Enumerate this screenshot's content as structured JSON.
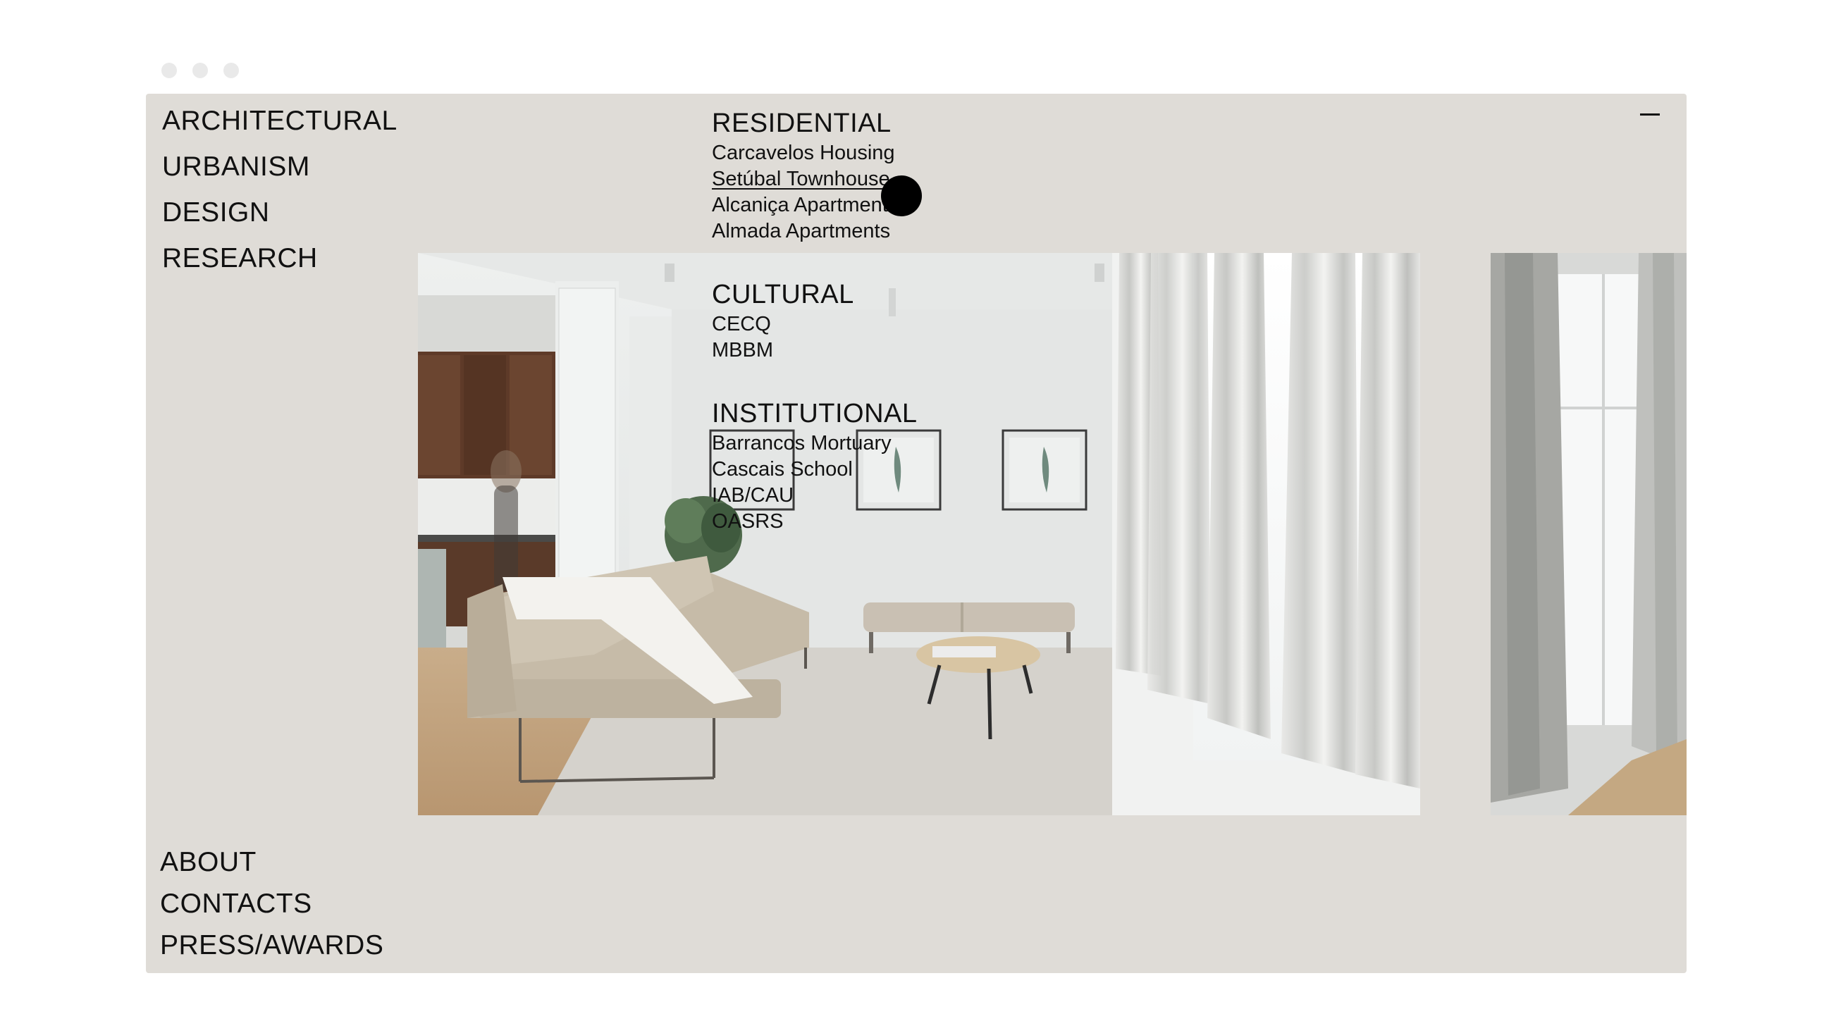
{
  "nav": {
    "main": [
      "ARCHITECTURAL",
      "URBANISM",
      "DESIGN",
      "RESEARCH"
    ],
    "footer": [
      "ABOUT",
      "CONTACTS",
      "PRESS/AWARDS"
    ]
  },
  "menu": {
    "categories": [
      {
        "title": "RESIDENTIAL",
        "items": [
          "Carcavelos Housing",
          "Setúbal Townhouse",
          "Alcaniça Apartments",
          "Almada Apartments"
        ]
      },
      {
        "title": "CULTURAL",
        "items": [
          "CECQ",
          "MBBM"
        ]
      },
      {
        "title": "INSTITUTIONAL",
        "items": [
          "Barrancos Mortuary",
          "Cascais School",
          "IAB/CAU",
          "OASRS"
        ]
      }
    ],
    "active_item": "Setúbal Townhouse"
  },
  "colors": {
    "background": "#dfdcd7",
    "text": "#111111",
    "window_dots": "#e9e9e9"
  },
  "icons": {
    "minimize": "minimize-icon",
    "cursor": "cursor-dot-icon"
  }
}
